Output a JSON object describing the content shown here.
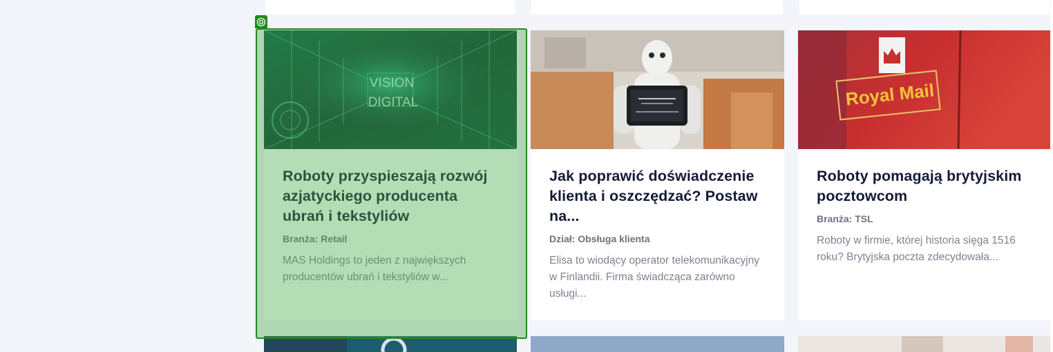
{
  "cards": [
    {
      "title": "Roboty przyspieszają rozwój azjatyckiego producenta ubrań i tekstyliów",
      "meta": "Branża: Retail",
      "excerpt": "MAS Holdings to jeden z największych producentów ubrań i tekstyliów w...",
      "image_text": [
        "VISION",
        "DIGITAL"
      ]
    },
    {
      "title": "Jak poprawić doświadczenie klienta i oszczędzać? Postaw na...",
      "meta": "Dział: Obsługa klienta",
      "excerpt": "Elisa to wiodący operator telekomunikacyjny w Finlandii. Firma świadcząca zarówno usługi..."
    },
    {
      "title": "Roboty pomagają brytyjskim pocztowcom",
      "meta": "Branża: TSL",
      "excerpt": "Roboty w firmie, której historia sięga 1516 roku? Brytyjska poczta zdecydowała...",
      "image_text": [
        "Royal Mail"
      ]
    }
  ],
  "colors": {
    "page_background": "#f3f5fa",
    "card_background": "#ffffff",
    "title": "#141a36",
    "meta": "#6c7280",
    "excerpt": "#7c8290",
    "highlight": "#1f8a1f"
  }
}
